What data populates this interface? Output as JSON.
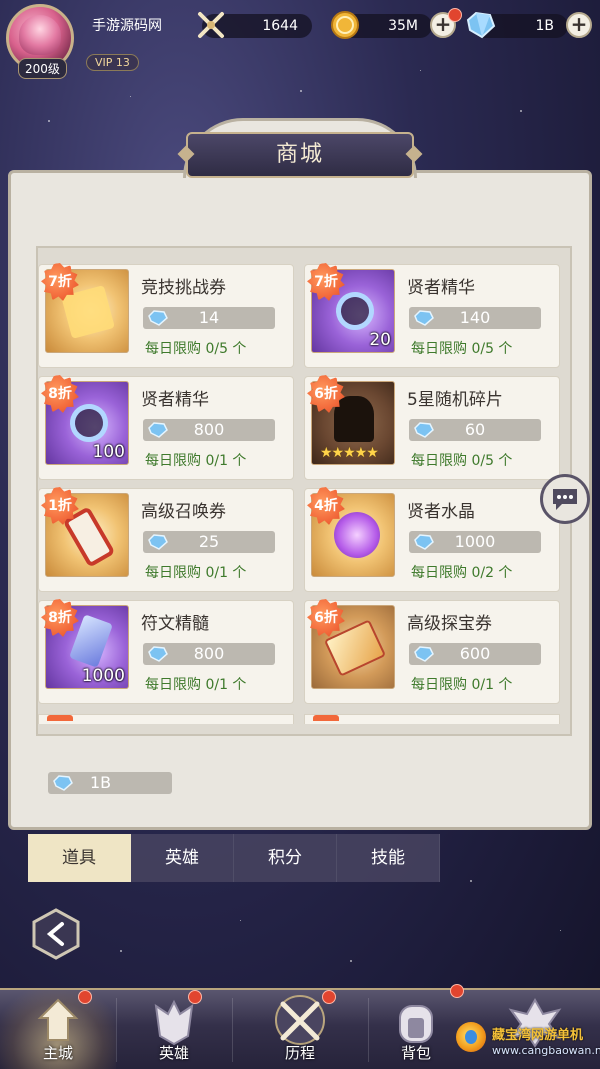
{
  "player": {
    "name": "手游源码网",
    "level": "200级",
    "vip": "VIP  13"
  },
  "resources": {
    "power": "1644",
    "gold": "35M",
    "diamonds": "1B"
  },
  "shop": {
    "title": "商城",
    "items": [
      {
        "discount": "7折",
        "name": "竞技挑战券",
        "price": "14",
        "limit": "每日限购 0/5 个",
        "quantity": "",
        "image": "ticket-icon"
      },
      {
        "discount": "7折",
        "name": "贤者精华",
        "price": "140",
        "limit": "每日限购 0/5 个",
        "quantity": "20",
        "image": "essence-icon"
      },
      {
        "discount": "8折",
        "name": "贤者精华",
        "price": "800",
        "limit": "每日限购 0/1 个",
        "quantity": "100",
        "image": "essence-icon"
      },
      {
        "discount": "6折",
        "name": "5星随机碎片",
        "price": "60",
        "limit": "每日限购 0/5 个",
        "quantity": "",
        "stars": "★★★★★",
        "image": "fragment-icon"
      },
      {
        "discount": "1折",
        "name": "高级召唤券",
        "price": "25",
        "limit": "每日限购 0/1 个",
        "quantity": "",
        "image": "scroll-icon"
      },
      {
        "discount": "4折",
        "name": "贤者水晶",
        "price": "1000",
        "limit": "每日限购 0/2 个",
        "quantity": "",
        "image": "crystal-icon"
      },
      {
        "discount": "8折",
        "name": "符文精髓",
        "price": "800",
        "limit": "每日限购 0/1 个",
        "quantity": "1000",
        "image": "rune-icon"
      },
      {
        "discount": "6折",
        "name": "高级探宝券",
        "price": "600",
        "limit": "每日限购 0/1 个",
        "quantity": "",
        "image": "treasure-ticket-icon"
      }
    ],
    "balance": "1B"
  },
  "tabs": [
    "道具",
    "英雄",
    "积分",
    "技能"
  ],
  "nav": [
    "主城",
    "英雄",
    "历程",
    "背包"
  ],
  "watermark": {
    "title": "藏宝湾网游单机",
    "url": "www.cangbaowan.net"
  },
  "colors": {
    "discount": "#f2683a",
    "limit_text": "#3f7a2c",
    "gem": "#7cc3f2",
    "active_tab": "#efe5c5"
  }
}
